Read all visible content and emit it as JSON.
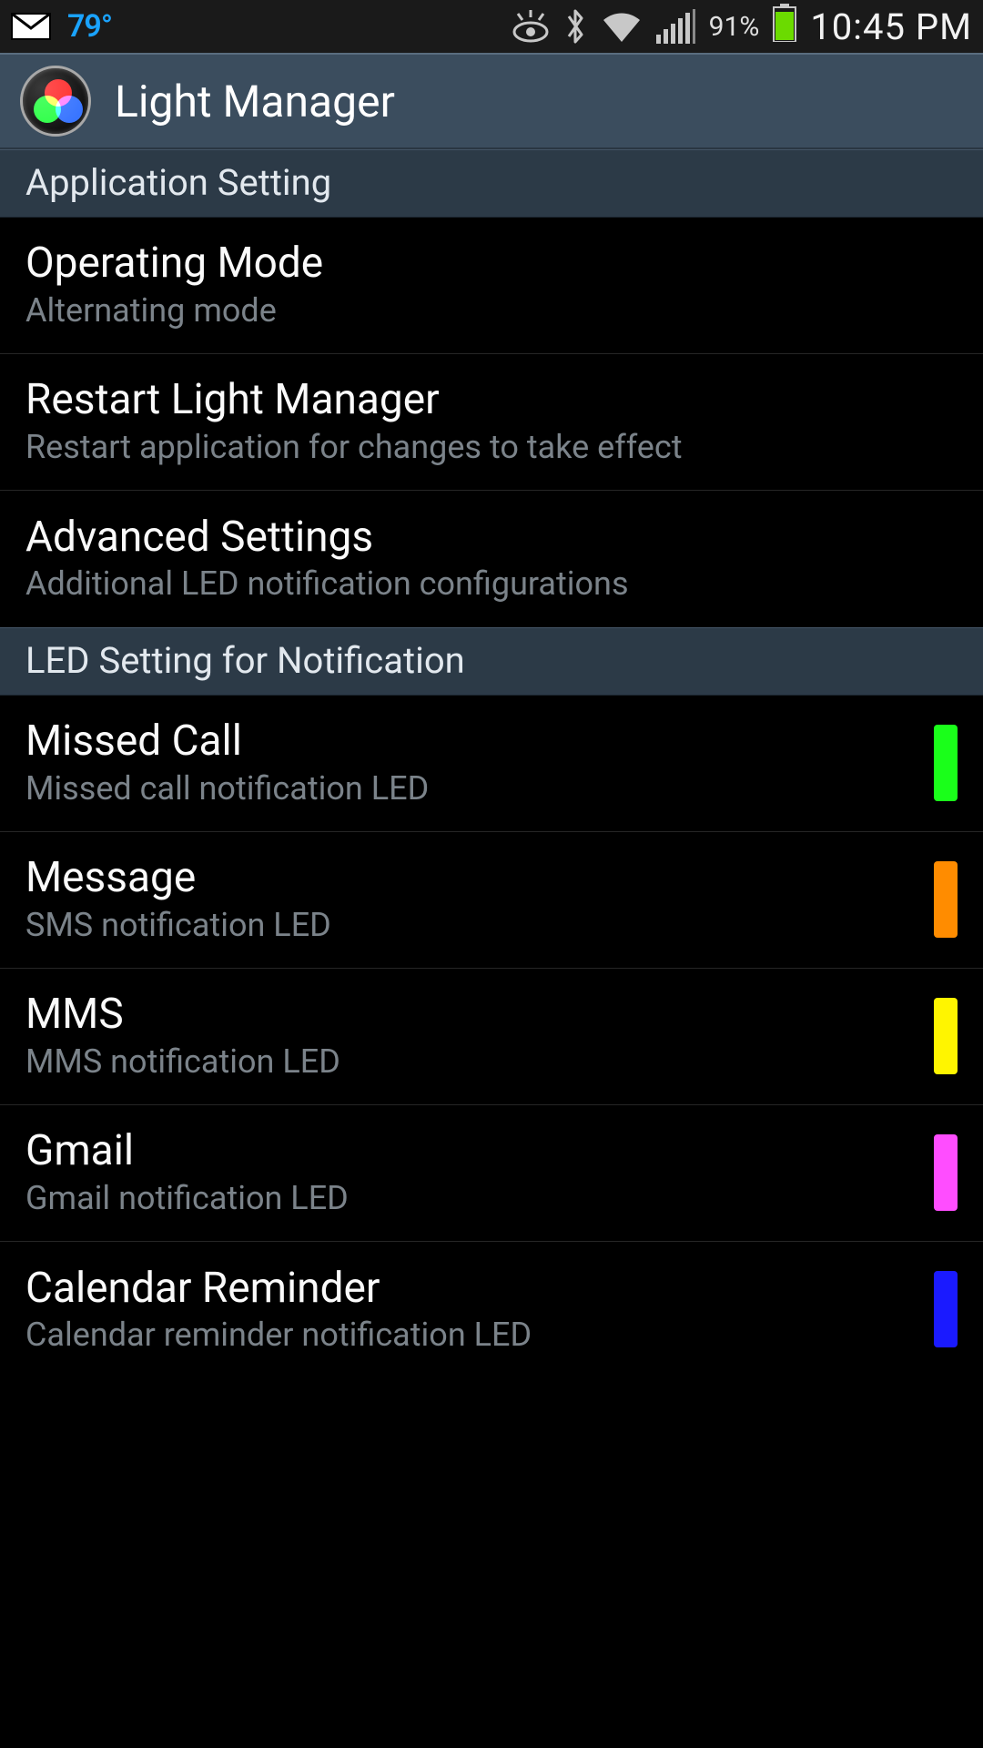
{
  "status": {
    "temperature": "79°",
    "battery_pct": "91%",
    "clock": "10:45 PM"
  },
  "app": {
    "title": "Light Manager"
  },
  "sections": {
    "app_setting": {
      "header": "Application Setting",
      "items": [
        {
          "title": "Operating Mode",
          "sub": "Alternating mode"
        },
        {
          "title": "Restart Light Manager",
          "sub": "Restart application for changes to take effect"
        },
        {
          "title": "Advanced Settings",
          "sub": "Additional LED notification configurations"
        }
      ]
    },
    "led_setting": {
      "header": "LED Setting for Notification",
      "items": [
        {
          "title": "Missed Call",
          "sub": "Missed call notification LED",
          "color": "#1aff1a"
        },
        {
          "title": "Message",
          "sub": "SMS notification LED",
          "color": "#ff8c00"
        },
        {
          "title": "MMS",
          "sub": "MMS notification LED",
          "color": "#fff500"
        },
        {
          "title": "Gmail",
          "sub": "Gmail notification LED",
          "color": "#ff4dff"
        },
        {
          "title": "Calendar Reminder",
          "sub": "Calendar reminder notification LED",
          "color": "#1a1aff"
        }
      ]
    }
  }
}
